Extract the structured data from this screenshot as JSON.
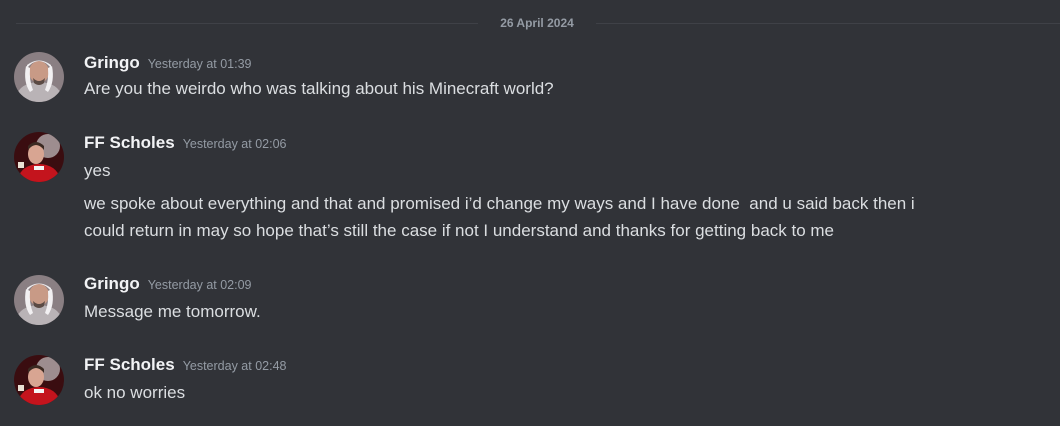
{
  "date_divider": "26 April 2024",
  "messages": [
    {
      "author": "Gringo",
      "timestamp": "Yesterday at 01:39",
      "avatar_icon": "gringo-avatar",
      "lines": [
        "Are you the weirdo who was talking about his Minecraft world?"
      ]
    },
    {
      "author": "FF Scholes",
      "timestamp": "Yesterday at 02:06",
      "avatar_icon": "ff-scholes-avatar",
      "lines": [
        "yes",
        "we spoke about everything and that and promised i’d change my ways and I have done  and u said back then i",
        "could return in may so hope that’s still the case if not I understand and thanks for getting back to me"
      ]
    },
    {
      "author": "Gringo",
      "timestamp": "Yesterday at 02:09",
      "avatar_icon": "gringo-avatar",
      "lines": [
        "Message me tomorrow."
      ]
    },
    {
      "author": "FF Scholes",
      "timestamp": "Yesterday at 02:48",
      "avatar_icon": "ff-scholes-avatar",
      "lines": [
        "ok no worries"
      ]
    }
  ]
}
